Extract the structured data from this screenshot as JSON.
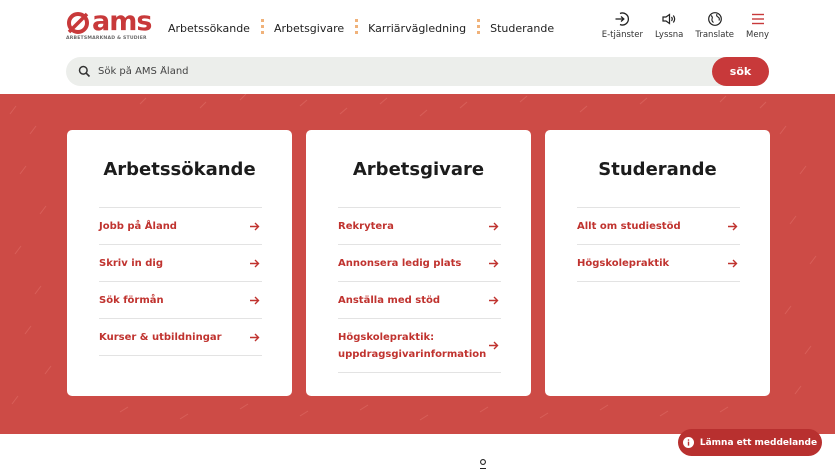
{
  "header": {
    "logo": {
      "word": "ams",
      "subtitle": "ARBETSMARKNAD & STUDIER"
    },
    "nav": [
      {
        "label": "Arbetssökande"
      },
      {
        "label": "Arbetsgivare"
      },
      {
        "label": "Karriärvägledning"
      },
      {
        "label": "Studerande"
      }
    ],
    "tools": [
      {
        "label": "E-tjänster",
        "icon": "login-arrow-icon"
      },
      {
        "label": "Lyssna",
        "icon": "speaker-icon"
      },
      {
        "label": "Translate",
        "icon": "globe-icon"
      },
      {
        "label": "Meny",
        "icon": "hamburger-menu-icon"
      }
    ]
  },
  "search": {
    "placeholder": "Sök på AMS Åland",
    "value": "",
    "button_label": "sök"
  },
  "cards": [
    {
      "title": "Arbetssökande",
      "links": [
        {
          "label": "Jobb på Åland"
        },
        {
          "label": "Skriv in dig"
        },
        {
          "label": "Sök förmån"
        },
        {
          "label": "Kurser & utbildningar"
        }
      ]
    },
    {
      "title": "Arbetsgivare",
      "links": [
        {
          "label": "Rekrytera"
        },
        {
          "label": "Annonsera ledig plats"
        },
        {
          "label": "Anställa med stöd"
        },
        {
          "label": "Högskolepraktik: uppdragsgivarinformation"
        }
      ]
    },
    {
      "title": "Studerande",
      "links": [
        {
          "label": "Allt om studiestöd"
        },
        {
          "label": "Högskolepraktik"
        }
      ]
    }
  ],
  "feedback": {
    "label": "Lämna ett meddelande"
  },
  "colors": {
    "brand_red": "#c8393a",
    "hero_red": "#cd4b46",
    "nav_separator": "#f0b27a"
  }
}
